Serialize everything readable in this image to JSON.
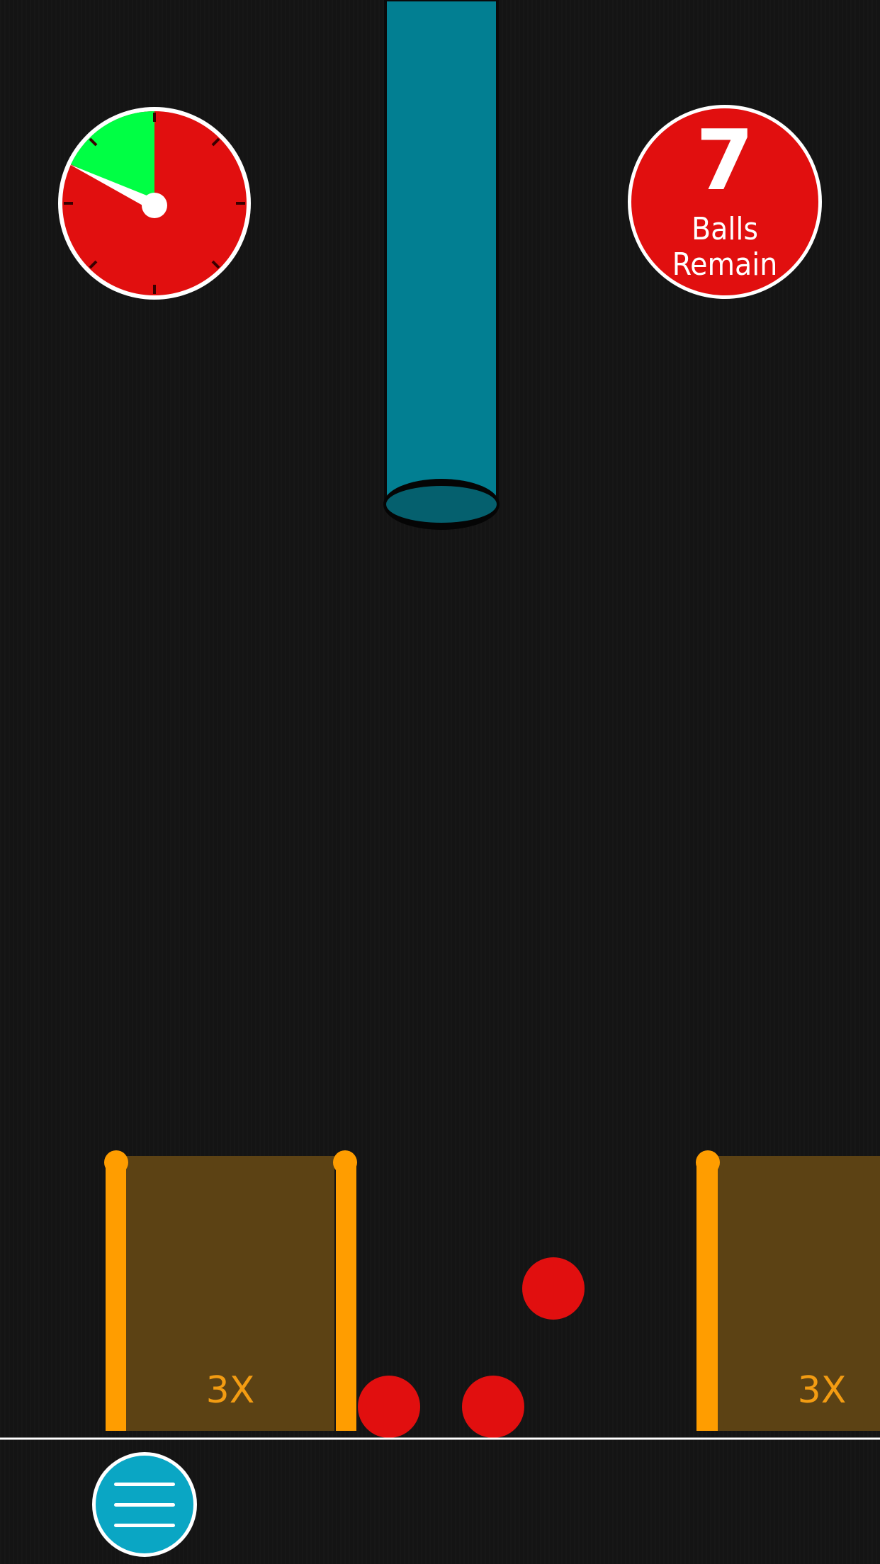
{
  "timer": {
    "icon": "stopwatch-timer-icon",
    "colors": {
      "face": "#e10f0f",
      "elapsed": "#00ff44",
      "rim": "#ffffff",
      "hand": "#ffffff"
    }
  },
  "balls_counter": {
    "count": "7",
    "caption_line1": "Balls",
    "caption_line2": "Remain",
    "color": "#e10f0f"
  },
  "dispenser": {
    "color": "#027f92",
    "icon": "tube-dispenser"
  },
  "buckets": [
    {
      "multiplier": "3X",
      "color": "#ff9d00"
    },
    {
      "multiplier": "3X",
      "color": "#ff9d00"
    }
  ],
  "balls": {
    "color": "#e10f0f",
    "count_visible": 3
  },
  "menu": {
    "icon": "hamburger-menu-icon",
    "color": "#0aa6c4"
  }
}
